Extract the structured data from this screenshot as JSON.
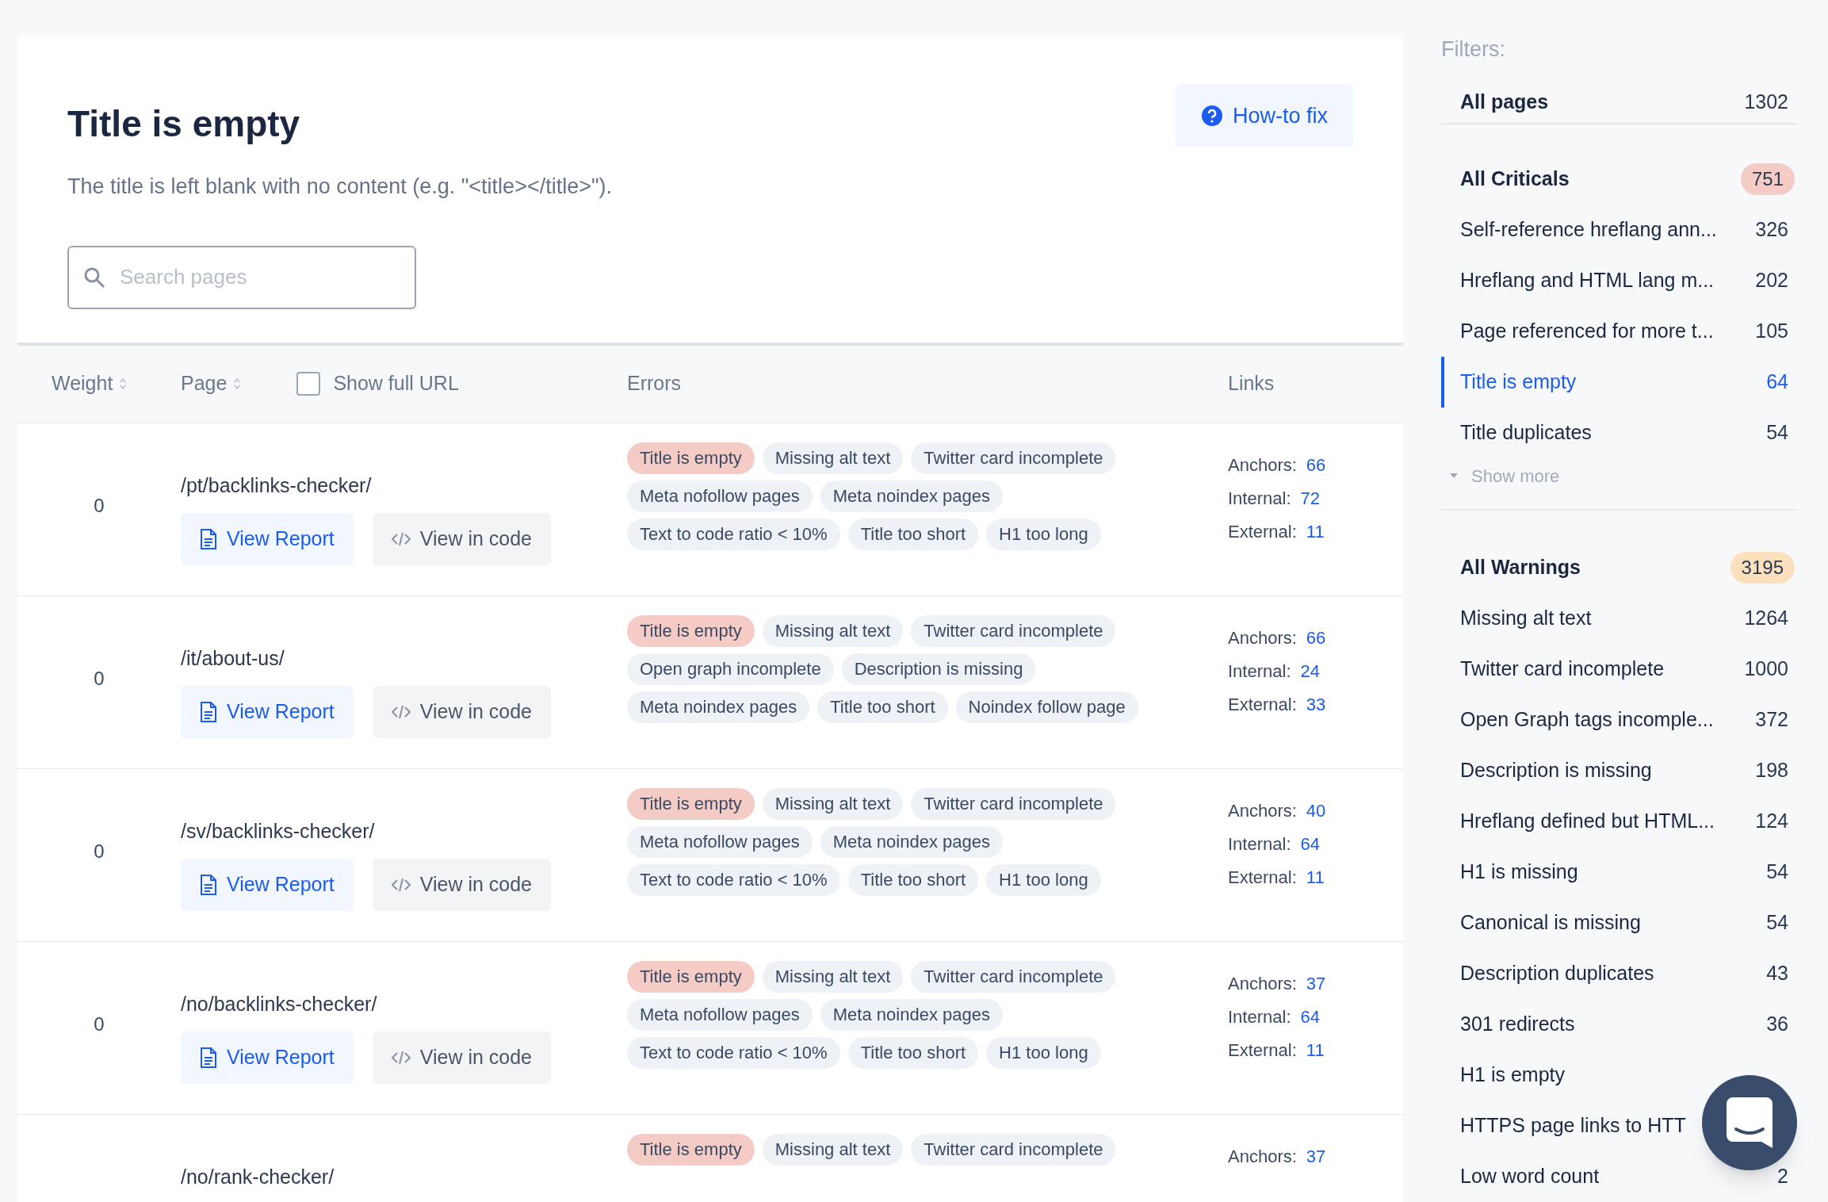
{
  "header": {
    "title": "Title is empty",
    "help_button": "How-to fix",
    "description": "The title is left blank with no content (e.g. \"<title></title>\").",
    "search": {
      "placeholder": "Search pages"
    }
  },
  "table": {
    "columns": [
      {
        "label": "Weight",
        "sortable": true
      },
      {
        "label": "Page",
        "sortable": true
      },
      {
        "label": "Errors",
        "sortable": false
      },
      {
        "label": "Links",
        "sortable": false
      }
    ],
    "show_full_url": {
      "label": "Show full URL",
      "checked": false
    },
    "rows": [
      {
        "weight": "0",
        "page": "/pt/backlinks-checker/",
        "buttons": [
          {
            "label": "View Report",
            "kind": "primary"
          },
          {
            "label": "View in code",
            "kind": "secondary"
          }
        ],
        "errors": [
          {
            "label": "Title is empty",
            "critical": true
          },
          {
            "label": "Missing alt text",
            "critical": false
          },
          {
            "label": "Twitter card incomplete",
            "critical": false
          },
          {
            "label": "Meta nofollow pages",
            "critical": false
          },
          {
            "label": "Meta noindex pages",
            "critical": false
          },
          {
            "label": "Text to code ratio < 10%",
            "critical": false
          },
          {
            "label": "Title too short",
            "critical": false
          },
          {
            "label": "H1 too long",
            "critical": false
          }
        ],
        "links": [
          {
            "label": "Anchors:",
            "value": "66"
          },
          {
            "label": "Internal:",
            "value": "72"
          },
          {
            "label": "External:",
            "value": "11"
          }
        ]
      },
      {
        "weight": "0",
        "page": "/it/about-us/",
        "buttons": [
          {
            "label": "View Report",
            "kind": "primary"
          },
          {
            "label": "View in code",
            "kind": "secondary"
          }
        ],
        "errors": [
          {
            "label": "Title is empty",
            "critical": true
          },
          {
            "label": "Missing alt text",
            "critical": false
          },
          {
            "label": "Twitter card incomplete",
            "critical": false
          },
          {
            "label": "Open graph incomplete",
            "critical": false
          },
          {
            "label": "Description is missing",
            "critical": false
          },
          {
            "label": "Meta noindex pages",
            "critical": false
          },
          {
            "label": "Title too short",
            "critical": false
          },
          {
            "label": "Noindex follow page",
            "critical": false
          }
        ],
        "links": [
          {
            "label": "Anchors:",
            "value": "66"
          },
          {
            "label": "Internal:",
            "value": "24"
          },
          {
            "label": "External:",
            "value": "33"
          }
        ]
      },
      {
        "weight": "0",
        "page": "/sv/backlinks-checker/",
        "buttons": [
          {
            "label": "View Report",
            "kind": "primary"
          },
          {
            "label": "View in code",
            "kind": "secondary"
          }
        ],
        "errors": [
          {
            "label": "Title is empty",
            "critical": true
          },
          {
            "label": "Missing alt text",
            "critical": false
          },
          {
            "label": "Twitter card incomplete",
            "critical": false
          },
          {
            "label": "Meta nofollow pages",
            "critical": false
          },
          {
            "label": "Meta noindex pages",
            "critical": false
          },
          {
            "label": "Text to code ratio < 10%",
            "critical": false
          },
          {
            "label": "Title too short",
            "critical": false
          },
          {
            "label": "H1 too long",
            "critical": false
          }
        ],
        "links": [
          {
            "label": "Anchors:",
            "value": "40"
          },
          {
            "label": "Internal:",
            "value": "64"
          },
          {
            "label": "External:",
            "value": "11"
          }
        ]
      },
      {
        "weight": "0",
        "page": "/no/backlinks-checker/",
        "buttons": [
          {
            "label": "View Report",
            "kind": "primary"
          },
          {
            "label": "View in code",
            "kind": "secondary"
          }
        ],
        "errors": [
          {
            "label": "Title is empty",
            "critical": true
          },
          {
            "label": "Missing alt text",
            "critical": false
          },
          {
            "label": "Twitter card incomplete",
            "critical": false
          },
          {
            "label": "Meta nofollow pages",
            "critical": false
          },
          {
            "label": "Meta noindex pages",
            "critical": false
          },
          {
            "label": "Text to code ratio < 10%",
            "critical": false
          },
          {
            "label": "Title too short",
            "critical": false
          },
          {
            "label": "H1 too long",
            "critical": false
          }
        ],
        "links": [
          {
            "label": "Anchors:",
            "value": "37"
          },
          {
            "label": "Internal:",
            "value": "64"
          },
          {
            "label": "External:",
            "value": "11"
          }
        ]
      },
      {
        "page": "/no/rank-checker/",
        "errors": [
          {
            "label": "Title is empty",
            "critical": true
          },
          {
            "label": "Missing alt text",
            "critical": false
          },
          {
            "label": "Twitter card incomplete",
            "critical": false
          }
        ],
        "links": [
          {
            "label": "Anchors:",
            "value": "37"
          }
        ]
      }
    ]
  },
  "sidebar": {
    "heading": "Filters:",
    "all_pages": {
      "label": "All pages",
      "count": "1302"
    },
    "groups": [
      {
        "title": "All Criticals",
        "count": "751",
        "color": "#f5cbc6",
        "items": [
          {
            "label": "Self-reference hreflang ann...",
            "count": "326",
            "selected": false
          },
          {
            "label": "Hreflang and HTML lang m...",
            "count": "202",
            "selected": false
          },
          {
            "label": "Page referenced for more t...",
            "count": "105",
            "selected": false
          },
          {
            "label": "Title is empty",
            "count": "64",
            "selected": true
          },
          {
            "label": "Title duplicates",
            "count": "54",
            "selected": false
          }
        ],
        "show_more": "Show more"
      },
      {
        "title": "All Warnings",
        "count": "3195",
        "color": "#fbe0bd",
        "items": [
          {
            "label": "Missing alt text",
            "count": "1264",
            "selected": false
          },
          {
            "label": "Twitter card incomplete",
            "count": "1000",
            "selected": false
          },
          {
            "label": "Open Graph tags incomple...",
            "count": "372",
            "selected": false
          },
          {
            "label": "Description is missing",
            "count": "198",
            "selected": false
          },
          {
            "label": "Hreflang defined but HTML...",
            "count": "124",
            "selected": false
          },
          {
            "label": "H1 is missing",
            "count": "54",
            "selected": false
          },
          {
            "label": "Canonical is missing",
            "count": "54",
            "selected": false
          },
          {
            "label": "Description duplicates",
            "count": "43",
            "selected": false
          },
          {
            "label": "301 redirects",
            "count": "36",
            "selected": false
          },
          {
            "label": "H1 is empty",
            "selected": false
          },
          {
            "label": "HTTPS page links to HTT",
            "selected": false
          },
          {
            "label": "Low word count",
            "count": "2",
            "selected": false
          }
        ]
      }
    ]
  }
}
